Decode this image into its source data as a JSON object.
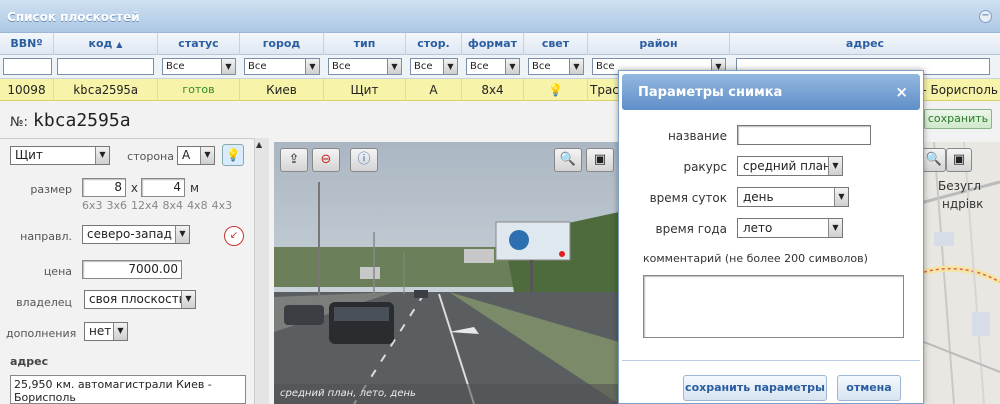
{
  "window": {
    "title": "Список плоскостей"
  },
  "grid": {
    "columns": [
      "BBNº",
      "код",
      "статус",
      "город",
      "тип",
      "стор.",
      "формат",
      "свет",
      "район",
      "адрес"
    ],
    "filters": [
      "",
      "",
      "Все",
      "Все",
      "Все",
      "Все",
      "Все",
      "Все",
      "Все",
      ""
    ],
    "row": {
      "bbn": "10098",
      "code": "kbca2595a",
      "status": "готов",
      "city": "Киев",
      "type": "Щит",
      "side": "А",
      "format": "8x4",
      "district": "Трас",
      "address": "- Борисполь"
    }
  },
  "detail": {
    "number_label": "№:",
    "number": "kbca2595a",
    "type_value": "Щит",
    "side_label": "сторона",
    "side_value": "А",
    "size_label": "размер",
    "size_w": "8",
    "size_x": "x",
    "size_h": "4",
    "size_unit": "м",
    "size_presets": [
      "6x3",
      "3x6",
      "12x4",
      "8x4",
      "4x8",
      "4x3"
    ],
    "direction_label": "направл.",
    "direction_value": "северо-запад",
    "price_label": "цена",
    "price_value": "7000.00",
    "owner_label": "владелец",
    "owner_value": "своя плоскость",
    "extras_label": "дополнения",
    "extras_value": "нет",
    "address_label": "адрес",
    "address_value": "25,950 км. автомагистрали Киев - Борисполь",
    "save_label": "сохранить",
    "photo_caption": "средний план, лето, день",
    "map_labels": [
      "Безугл",
      "ндрівк"
    ]
  },
  "modal": {
    "title": "Параметры снимка",
    "close": "×",
    "name_label": "название",
    "name_value": "",
    "angle_label": "ракурс",
    "angle_value": "средний план",
    "daytime_label": "время суток",
    "daytime_value": "день",
    "season_label": "время года",
    "season_value": "лето",
    "comment_label": "комментарий (не более 200 символов)",
    "save_button": "сохранить параметры",
    "cancel_button": "отмена"
  }
}
